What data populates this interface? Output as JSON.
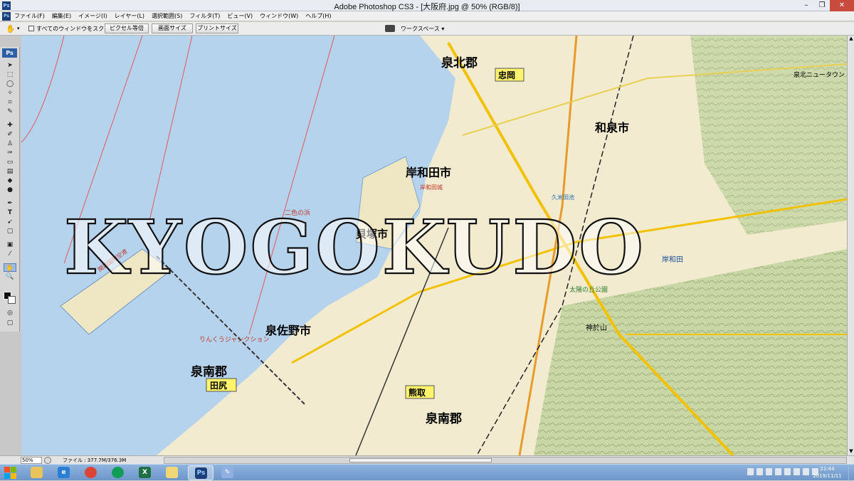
{
  "window": {
    "title": "Adobe Photoshop CS3 - [大阪府.jpg @ 50% (RGB/8)]",
    "app_icon": "Ps",
    "buttons": [
      "minimize-icon",
      "restore-icon",
      "close-icon"
    ]
  },
  "menu": {
    "items": [
      "ファイル(F)",
      "編集(E)",
      "イメージ(I)",
      "レイヤー(L)",
      "選択範囲(S)",
      "フィルタ(T)",
      "ビュー(V)",
      "ウィンドウ(W)",
      "ヘルプ(H)"
    ]
  },
  "options": {
    "scroll_all": "すべてのウィンドウをスクロール",
    "buttons": [
      "ピクセル等倍",
      "画面サイズ",
      "プリントサイズ"
    ],
    "workspace": "ワークスペース ▾"
  },
  "toolbox": {
    "logo": "Ps",
    "tools": [
      "move-tool",
      "marquee-tool",
      "lasso-tool",
      "magic-wand-tool",
      "crop-tool",
      "slice-tool",
      "healing-tool",
      "brush-tool",
      "stamp-tool",
      "history-brush-tool",
      "eraser-tool",
      "gradient-tool",
      "blur-tool",
      "dodge-tool",
      "pen-tool",
      "type-tool",
      "path-select-tool",
      "shape-tool",
      "notes-tool",
      "eyedropper-tool",
      "hand-tool",
      "zoom-tool"
    ]
  },
  "document": {
    "watermark": "KYOGOKUDO",
    "map_labels": {
      "senboku_gun": "泉北郡",
      "tadaoka": "忠岡",
      "izumi_shi": "和泉市",
      "kishiwada_shi": "岸和田市",
      "kaizuka_shi": "貝塚市",
      "izumisano_shi": "泉佐野市",
      "sennan_gun_left": "泉南郡",
      "tajiri": "田尻",
      "kumatori": "熊取",
      "sennan_gun_bottom": "泉南郡",
      "kansai_airport": "関西国際空港",
      "rinku_junction": "りんくうジャンクション",
      "kamikami_yama": "神於山",
      "nishiki_no_hama": "二色の浜",
      "senboku_newtown": "泉北ニュータウン",
      "kishiwada_jo": "岸和田城",
      "kumeda_ike": "久米田池",
      "kishiwada_right": "岸和田",
      "taishi_gun": "太陽の丘公園"
    }
  },
  "status": {
    "zoom": "50%",
    "file_info": "ファイル : 377.7M/376.3M"
  },
  "taskbar": {
    "apps": [
      "folder-icon",
      "ie-icon",
      "chrome-icon",
      "chrome-alt-icon",
      "excel-icon",
      "explorer-icon",
      "photoshop-icon",
      "paint-icon"
    ],
    "time": "21:44",
    "date": "2019/11/11"
  }
}
